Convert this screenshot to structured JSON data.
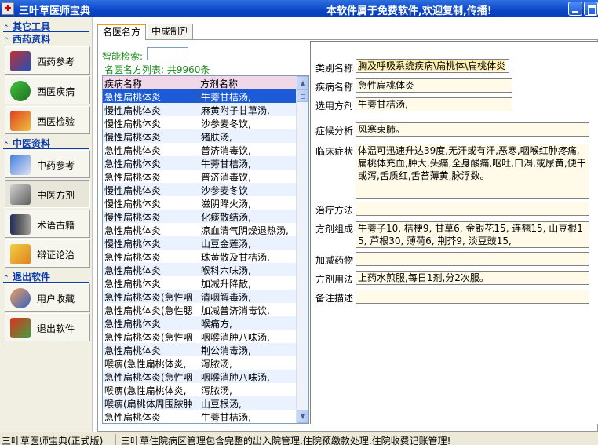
{
  "window": {
    "title": "三叶草医师宝典",
    "slogan": "本软件属于免费软件,欢迎复制,传播!"
  },
  "sidebar": {
    "other_tools": "其它工具",
    "western": "西药资料",
    "tcm": "中医资料",
    "exit": "退出软件",
    "items": [
      {
        "label": "西药参考",
        "icon": "western-medicine-book-icon"
      },
      {
        "label": "西医疾病",
        "icon": "capsule-icon"
      },
      {
        "label": "西医检验",
        "icon": "lab-test-icon"
      },
      {
        "label": "中药参考",
        "icon": "herb-jar-icon"
      },
      {
        "label": "中医方剂",
        "icon": "prescription-pen-icon"
      },
      {
        "label": "术语古籍",
        "icon": "ancient-books-icon"
      },
      {
        "label": "辩证论治",
        "icon": "diagnosis-chart-icon"
      },
      {
        "label": "用户收藏",
        "icon": "users-icon"
      },
      {
        "label": "退出软件",
        "icon": "exit-door-icon"
      }
    ]
  },
  "tabs": [
    {
      "label": "名医名方"
    },
    {
      "label": "中成制剂"
    }
  ],
  "search": {
    "label": "智能检索:",
    "value": "",
    "count_text": "名医名方列表: 共9960条"
  },
  "table": {
    "headers": [
      "疾病名称",
      "方剂名称"
    ],
    "rows": [
      [
        "急性扁桃体炎",
        "牛蒡甘桔汤,"
      ],
      [
        "慢性扁桃体炎",
        "麻黄附子甘草汤,"
      ],
      [
        "慢性扁桃体炎",
        "沙参麦冬饮,"
      ],
      [
        "慢性扁桃体炎",
        "猪肤汤,"
      ],
      [
        "急性扁桃体炎",
        "普济消毒饮,"
      ],
      [
        "急性扁桃体炎",
        "牛蒡甘桔汤,"
      ],
      [
        "急性扁桃体炎",
        "普济消毒饮,"
      ],
      [
        "慢性扁桃体炎",
        "沙参麦冬饮"
      ],
      [
        "慢性扁桃体炎",
        "滋阴降火汤,"
      ],
      [
        "慢性扁桃体炎",
        "化痰散结汤,"
      ],
      [
        "急性扁桃体炎",
        "凉血清气阴燥退热汤,"
      ],
      [
        "慢性扁桃体炎",
        "山豆金莲汤,"
      ],
      [
        "急性扁桃体炎",
        "珠黄散及甘桔汤,"
      ],
      [
        "急性扁桃体炎",
        "喉科六味汤,"
      ],
      [
        "急性扁桃体炎",
        "加减升降散,"
      ],
      [
        "急性扁桃体炎(急性咽",
        "清咽解毒汤,"
      ],
      [
        "急性扁桃体炎(急性腮",
        "加减普济消毒饮,"
      ],
      [
        "急性扁桃体炎",
        "喉痛方,"
      ],
      [
        "急性扁桃体炎(急性咽",
        "咽喉消肿八味汤,"
      ],
      [
        "急性扁桃体炎",
        "荆公消毒汤,"
      ],
      [
        "喉痹(急性扁桃体炎,",
        "泻脓汤,"
      ],
      [
        "急性扁桃体炎(急性咽",
        "咽喉消肿八味汤,"
      ],
      [
        "喉痹(急性扁桃体炎,",
        "泻脓汤,"
      ],
      [
        "喉痹(扁桃体周围脓肿",
        "山豆根汤,"
      ],
      [
        "急性扁桃体炎",
        "牛蒡甘桔汤,"
      ]
    ]
  },
  "detail": {
    "category_label": "类别名称",
    "category_value": "胸及呼吸系统疾病\\扁桃体\\扁桃体炎",
    "disease_label": "疾病名称",
    "disease_value": "急性扁桃体炎",
    "formula_label": "选用方剂",
    "formula_value": "牛蒡甘桔汤,",
    "syndrome_label": "症候分析",
    "syndrome_value": "风寒束肺。",
    "symptoms_label": "临床症状",
    "symptoms_value": "体温可迅速升达39度,无汗或有汗,恶寒,咽喉红肿疼痛,扁桃体充血,肿大,头痛,全身酸痛,呕吐,口渴,或尿黄,便干或泻,舌质红,舌苔薄黄,脉浮数。",
    "treatment_label": "治疗方法",
    "treatment_value": "",
    "composition_label": "方剂组成",
    "composition_value": "牛蒡子10, 桔梗9, 甘草6, 金银花15, 连翘15, 山豆根15, 芦根30, 薄荷6, 荆芥9, 淡豆豉15,",
    "modification_label": "加减药物",
    "modification_value": "",
    "usage_label": "方剂用法",
    "usage_value": "上药水煎服,每日1剂,分2次服。",
    "notes_label": "备注描述",
    "notes_value": ""
  },
  "statusbar": {
    "left": "三叶草医师宝典(正式版)",
    "right": "三叶草住院病区管理包含完整的出入院管理,住院预缴款处理,住院收费记账管理!"
  }
}
